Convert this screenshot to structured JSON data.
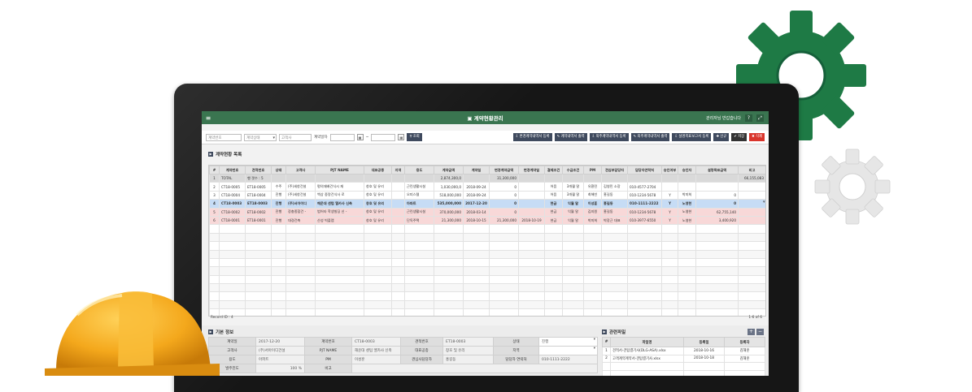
{
  "app": {
    "title": "계약현황관리",
    "notice": "관리자님 반갑습니다",
    "help": "?",
    "expand": "⤢"
  },
  "search": {
    "contract_no_placeholder": "계약번호",
    "status_placeholder": "계약상태",
    "client_placeholder": "고객사",
    "date_label": "계약일자",
    "date_sep": "~",
    "search_label": "조회"
  },
  "toolbar": {
    "buttons": [
      "변경계약내역서 등록",
      "계약내역서 출력",
      "외주계약내역서 등록",
      "외주계약내역서 출력",
      "설명목표보고서 등록"
    ],
    "new_label": "신규",
    "save_label": "저장",
    "delete_label": "삭제"
  },
  "list": {
    "title": "계약현황 목록",
    "columns": [
      "#",
      "계약번호",
      "견적번호",
      "상태",
      "고객사",
      "PJT NAME",
      "대표공종",
      "지역",
      "용도",
      "계약금액",
      "계약일",
      "변경계약금액",
      "변경계약일",
      "결제조건",
      "수금조건",
      "PM",
      "견심부담당자",
      "담당자연락처",
      "승인여부",
      "승인자",
      "설명목표금액",
      "비고"
    ],
    "total_row": [
      "1",
      "TOTAL",
      "행 갯수 : 5",
      "",
      "",
      "",
      "",
      "",
      "",
      "2,874,300,0",
      "",
      "31,300,000",
      "",
      "",
      "",
      "",
      "",
      "",
      "",
      "",
      "",
      "66,155,083",
      ""
    ],
    "rows": [
      [
        "2",
        "CT18-0005",
        "ET18-0005",
        "수주",
        "(주)세창건설",
        "평의재배건식시 재",
        "창호 및 유리",
        "",
        "근린생활시설",
        "1,030,000,0",
        "2018-09-24",
        "0",
        "",
        "어음",
        "3개월 말",
        "유환민",
        "김영민 소장",
        "010-4577-2704",
        "",
        "",
        "",
        ""
      ],
      [
        "3",
        "CT18-0004",
        "ET18-0004",
        "진행",
        "(주)세창건설",
        "백상 중량건식사 로",
        "창호 및 유리",
        "",
        "오피스텔",
        "518,000,000",
        "2018-09-24",
        "0",
        "",
        "어음",
        "3개월 말",
        "최해빈",
        "홍길동",
        "010-1234-5678",
        "Y",
        "박미희",
        "0",
        ""
      ],
      [
        "4",
        "CT18-0003",
        "ET18-0003",
        "진행",
        "(주)서아이디",
        "해운대 센텀 엘카사 신축",
        "창호 및 유리",
        "",
        "아파트",
        "535,000,000",
        "2017-12-20",
        "0",
        "",
        "현금",
        "익월 말",
        "이성훈",
        "홍길동",
        "010-1111-2222",
        "Y",
        "노영현",
        "0",
        ""
      ],
      [
        "5",
        "CT18-0002",
        "ET18-0002",
        "진행",
        "장충종합건 -",
        "범어타 학생빌딩 신 -",
        "창호 및 유리",
        "",
        "근린생활시설",
        "370,000,000",
        "2018-03-14",
        "0",
        "",
        "현금",
        "익월 말",
        "김지원",
        "홍길동",
        "010-1234-5678",
        "Y",
        "노영현",
        "62,755,140",
        ""
      ],
      [
        "6",
        "CT18-0001",
        "ET18-0001",
        "진행",
        "대경건축",
        "산성 빅플랩",
        "창호 및 유리",
        "",
        "단독주택",
        "21,300,000",
        "2018-10-15",
        "21,300,000",
        "2018-10-19",
        "현금",
        "익월 말",
        "박미희",
        "박장근 대표",
        "010-3977-6550",
        "Y",
        "노영현",
        "3,400,920",
        ""
      ]
    ],
    "record_label": "Record ID : 4",
    "page_info": "1-6 of 6"
  },
  "info": {
    "title": "기본 정보",
    "rows": [
      [
        {
          "h": "계약일"
        },
        {
          "v": "2017-12-20"
        },
        {
          "h": "계약번호"
        },
        {
          "v": "CT18-0003"
        },
        {
          "h": "견적번호"
        },
        {
          "v": "ET18-0003"
        },
        {
          "h": "상태"
        },
        {
          "v": "진행",
          "sel": true
        }
      ],
      [
        {
          "h": "고객사"
        },
        {
          "v": "(주)서아이디건설"
        },
        {
          "h": "PJT NAME"
        },
        {
          "v": "해운대 센텀 엘카사 신축"
        },
        {
          "h": "대표공종"
        },
        {
          "v": "창호 및 유리"
        },
        {
          "h": "지역"
        },
        {
          "v": "",
          "sel": true
        }
      ],
      [
        {
          "h": "용도"
        },
        {
          "v": "아파트"
        },
        {
          "h": "PM"
        },
        {
          "v": "이성훈"
        },
        {
          "h": "견심사담당자"
        },
        {
          "v": "홍길동"
        },
        {
          "h": "담당자 연락처"
        },
        {
          "v": "010-1111-2222"
        }
      ],
      [
        {
          "h": "발주진도"
        },
        {
          "v": "100",
          "unit": "%"
        },
        {
          "h": "비고"
        },
        {
          "v": "",
          "span": 5
        }
      ]
    ]
  },
  "files": {
    "title": "관련파일",
    "columns": [
      "#",
      "파일명",
      "등록일",
      "등록자"
    ],
    "rows": [
      [
        "1",
        "견적서-견탑결기사(DLG-ASA).xlsx",
        "2018-10-16",
        "김해훈"
      ],
      [
        "2",
        "고객계약계약서-견탑결기사.xlsx",
        "2018-10-18",
        "김해훈"
      ]
    ],
    "add": "+",
    "remove": "−"
  },
  "colors": {
    "titlebar": "#3a7550",
    "gear_green": "#1e7a45",
    "gear_grey": "#e6e6e6",
    "helmet": "#f4a81c",
    "selected_row": "#c6dcf5",
    "pink_row": "#f8d8d8"
  }
}
